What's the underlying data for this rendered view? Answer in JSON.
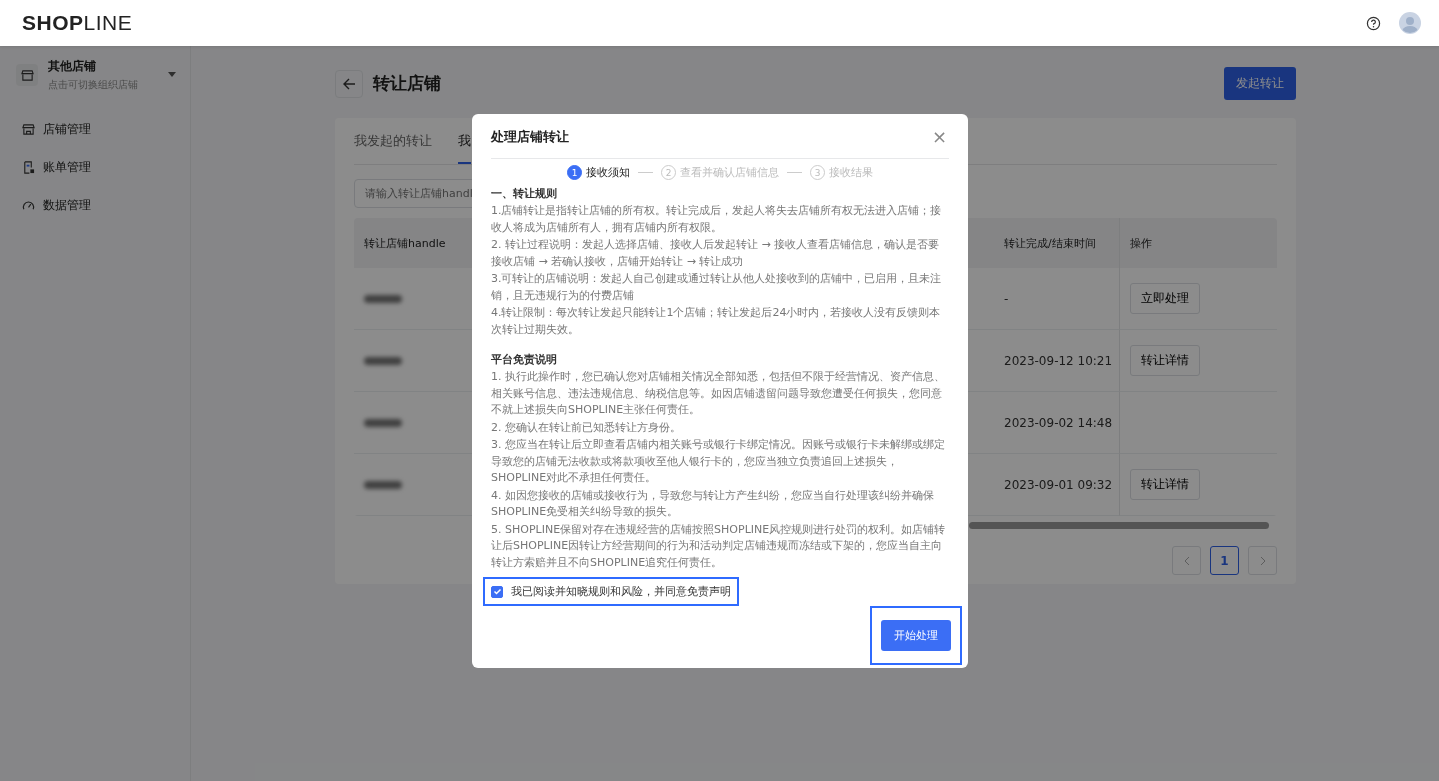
{
  "header": {
    "logo": "**SHOP**LINE"
  },
  "sidebar": {
    "store": {
      "name": "其他店铺",
      "hint": "点击可切换组织店铺"
    },
    "items": [
      {
        "label": "店铺管理"
      },
      {
        "label": "账单管理"
      },
      {
        "label": "数据管理"
      }
    ]
  },
  "page": {
    "title": "转让店铺",
    "primary_button": "发起转让"
  },
  "tabs": [
    {
      "label": "我发起的转让",
      "selected": false
    },
    {
      "label": "我",
      "selected": true
    }
  ],
  "search": {
    "placeholder": "请输入转让店铺handl"
  },
  "table": {
    "columns": [
      "转让店铺handle",
      "转让完成/结束时间",
      "操作"
    ],
    "rows": [
      {
        "time": "-",
        "action": "立即处理"
      },
      {
        "time": "2023-09-12 10:21",
        "action": "转让详情"
      },
      {
        "time": "2023-09-02 14:48"
      },
      {
        "time": "2023-09-01 09:32",
        "action": "转让详情"
      }
    ]
  },
  "pagination": {
    "pages": [
      {
        "label": "1",
        "selected": true
      }
    ]
  },
  "modal": {
    "title": "处理店铺转让",
    "close": "×",
    "steps": [
      {
        "number": "1",
        "label": "接收须知",
        "active": true
      },
      {
        "number": "2",
        "label": "查看并确认店铺信息",
        "active": false
      },
      {
        "number": "3",
        "label": "接收结果",
        "active": false
      }
    ],
    "sections": [
      {
        "heading": "一、转让规则",
        "paragraphs": [
          "1.店铺转让是指转让店铺的所有权。转让完成后，发起人将失去店铺所有权无法进入店铺；接收人将成为店铺所有人，拥有店铺内所有权限。",
          "2. 转让过程说明：发起人选择店铺、接收人后发起转让 → 接收人查看店铺信息，确认是否要接收店铺 → 若确认接收，店铺开始转让 → 转让成功",
          "3.可转让的店铺说明：发起人自己创建或通过转让从他人处接收到的店铺中，已启用，且未注销，且无违规行为的付费店铺",
          "4.转让限制：每次转让发起只能转让1个店铺；转让发起后24小时内，若接收人没有反馈则本次转让过期失效。"
        ]
      },
      {
        "heading": "平台免责说明",
        "paragraphs": [
          "1. 执行此操作时，您已确认您对店铺相关情况全部知悉，包括但不限于经营情况、资产信息、相关账号信息、违法违规信息、纳税信息等。如因店铺遗留问题导致您遭受任何损失，您同意不就上述损失向SHOPLINE主张任何责任。",
          "2. 您确认在转让前已知悉转让方身份。",
          "3. 您应当在转让后立即查看店铺内相关账号或银行卡绑定情况。因账号或银行卡未解绑或绑定导致您的店铺无法收款或将款项收至他人银行卡的，您应当独立负责追回上述损失，SHOPLINE对此不承担任何责任。",
          "4. 如因您接收的店铺或接收行为，导致您与转让方产生纠纷，您应当自行处理该纠纷并确保SHOPLINE免受相关纠纷导致的损失。",
          "5. SHOPLINE保留对存在违规经营的店铺按照SHOPLINE风控规则进行处罚的权利。如店铺转让后SHOPLINE因转让方经营期间的行为和活动判定店铺违规而冻结或下架的，您应当自主向转让方索赔并且不向SHOPLINE追究任何责任。"
        ]
      }
    ],
    "agreement": {
      "label": "我已阅读并知晓规则和风险，并同意免责声明",
      "checked": true,
      "highlighted": true
    },
    "confirm_button": {
      "label": "开始处理",
      "highlighted": true
    }
  }
}
